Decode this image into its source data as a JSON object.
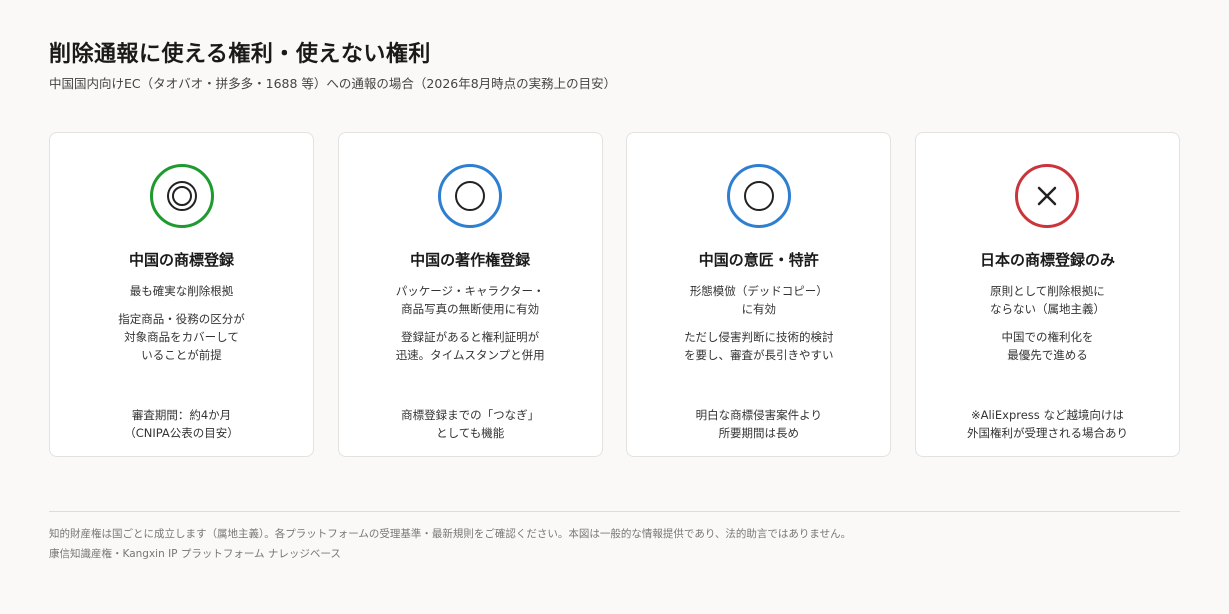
{
  "header": {
    "title": "削除通報に使える権利・使えない権利",
    "subtitle": "中国国内向けEC（タオバオ・拼多多・1688 等）への通報の場合（2026年8月時点の実務上の目安）"
  },
  "cards": [
    {
      "symbol": "double-circle-icon",
      "symbol_color": "#1e9a2e",
      "title": "中国の商標登録",
      "lines": [
        "最も確実な削除根拠",
        "指定商品・役務の区分が\n対象商品をカバーして\nいることが前提"
      ],
      "note": "審査期間：約4か月\n（CNIPA公表の目安）"
    },
    {
      "symbol": "circle-icon",
      "symbol_color": "#2f7fd1",
      "title": "中国の著作権登録",
      "lines": [
        "パッケージ・キャラクター・\n商品写真の無断使用に有効",
        "登録証があると権利証明が\n迅速。タイムスタンプと併用"
      ],
      "note": "商標登録までの「つなぎ」\nとしても機能"
    },
    {
      "symbol": "circle-icon",
      "symbol_color": "#2f7fd1",
      "title": "中国の意匠・特許",
      "lines": [
        "形態模倣（デッドコピー）\nに有効",
        "ただし侵害判断に技術的検討\nを要し、審査が長引きやすい"
      ],
      "note": "明白な商標侵害案件より\n所要期間は長め"
    },
    {
      "symbol": "cross-icon",
      "symbol_color": "#c9353a",
      "title": "日本の商標登録のみ",
      "lines": [
        "原則として削除根拠に\nならない（属地主義）",
        "中国での権利化を\n最優先で進める"
      ],
      "note": "※AliExpress など越境向けは\n外国権利が受理される場合あり"
    }
  ],
  "footer": {
    "line1": "知的財産権は国ごとに成立します（属地主義）。各プラットフォームの受理基準・最新規則をご確認ください。本図は一般的な情報提供であり、法的助言ではありません。",
    "line2": "康信知識産権・Kangxin IP プラットフォーム ナレッジベース"
  }
}
